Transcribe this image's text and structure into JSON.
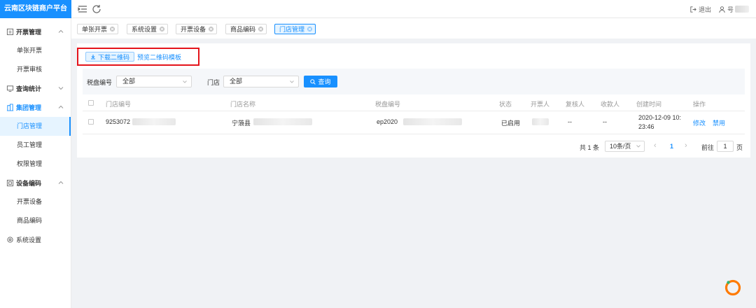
{
  "brand": {
    "title": "云南区块链商户平台"
  },
  "topbar": {
    "logout_label": "退出",
    "user_partial": "号"
  },
  "sidebar": {
    "groups": [
      {
        "label": "开票管理",
        "items": [
          "单张开票",
          "开票审核"
        ]
      },
      {
        "label": "查询统计",
        "items": []
      },
      {
        "label": "集团管理",
        "items": [
          "门店管理",
          "员工管理",
          "权限管理"
        ]
      },
      {
        "label": "设备编码",
        "items": [
          "开票设备",
          "商品编码"
        ]
      },
      {
        "label": "系统设置",
        "items": []
      }
    ]
  },
  "tabs": [
    "单张开票",
    "系统设置",
    "开票设备",
    "商品编码",
    "门店管理"
  ],
  "toolbar": {
    "download_label": "下载二维码",
    "preview_label": "预览二维码模板"
  },
  "filters": {
    "tax_label": "税盘编号",
    "tax_value": "全部",
    "store_label": "门店",
    "store_value": "全部",
    "query_label": "查询"
  },
  "table": {
    "headers": [
      "门店编号",
      "门店名称",
      "税盘编号",
      "状态",
      "开票人",
      "复核人",
      "收款人",
      "创建时间",
      "操作"
    ],
    "rows": [
      {
        "store_no": "9253072",
        "store_name": "宁蒗县",
        "tax_no": "ep2020",
        "status": "已启用",
        "reviewer": "--",
        "payee": "--",
        "created_line1": "2020-12-09 10:",
        "created_line2": "23:46",
        "edit": "修改",
        "disable": "禁用"
      }
    ]
  },
  "pagination": {
    "total": "共 1 条",
    "page_size": "10条/页",
    "current": "1",
    "goto_label": "前往",
    "goto_value": "1",
    "page_suffix": "页",
    "prev": "‹",
    "next": "›"
  },
  "colors": {
    "brand": "#1890ff",
    "highlight": "#e4141b",
    "loader": "#ff7a00"
  }
}
